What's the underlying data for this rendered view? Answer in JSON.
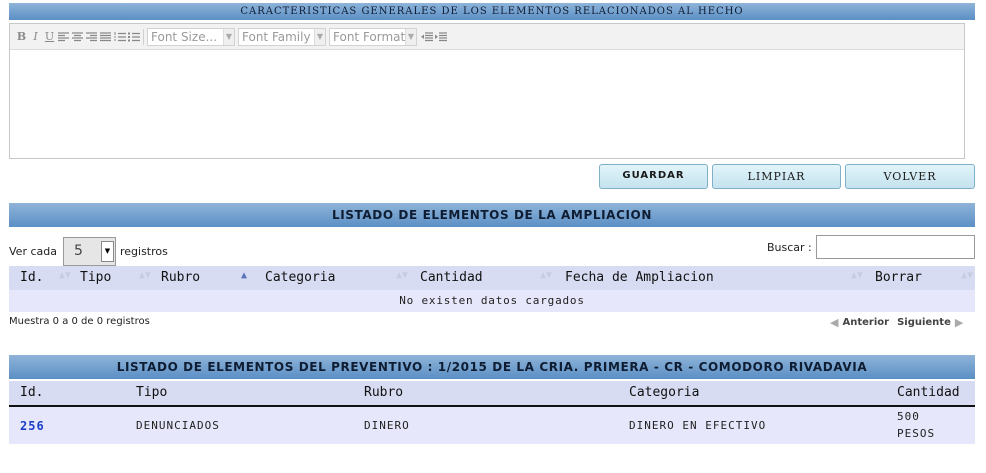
{
  "header_generales": "CARACTERISTICAS GENERALES DE LOS ELEMENTOS RELACIONADOS AL HECHO",
  "toolbar": {
    "bold": "B",
    "italic": "I",
    "underline": "U",
    "font_size": "Font Size...",
    "font_family": "Font Family",
    "font_format": "Font Format",
    "icons": [
      "bold-icon",
      "italic-icon",
      "underline-icon",
      "align-left-icon",
      "align-center-icon",
      "align-right-icon",
      "align-justify-icon",
      "ordered-list-icon",
      "unordered-list-icon",
      "outdent-icon",
      "indent-icon"
    ]
  },
  "buttons": {
    "guardar": "GUARDAR",
    "limpiar": "LIMPIAR",
    "volver": "VOLVER"
  },
  "ampliacion": {
    "title": "LISTADO DE ELEMENTOS DE LA AMPLIACION",
    "ver_cada": "Ver cada",
    "page_size": "5",
    "registros": "registros",
    "buscar": "Buscar :",
    "columns": [
      "Id.",
      "Tipo",
      "Rubro",
      "Categoria",
      "Cantidad",
      "Fecha de Ampliacion",
      "Borrar"
    ],
    "empty": "No existen datos cargados",
    "muestra": "Muestra 0 a 0 de 0 registros",
    "anterior": "Anterior",
    "siguiente": "Siguiente"
  },
  "preventivo": {
    "title": "LISTADO DE ELEMENTOS DEL PREVENTIVO : 1/2015 DE LA CRIA. PRIMERA - CR - COMODORO RIVADAVIA",
    "columns": [
      "Id.",
      "Tipo",
      "Rubro",
      "Categoria",
      "Cantidad"
    ],
    "rows": [
      {
        "id": "256",
        "tipo": "DENUNCIADOS",
        "rubro": "DINERO",
        "categoria": "DINERO EN EFECTIVO",
        "cantidad_1": "500",
        "cantidad_2": "PESOS"
      }
    ]
  },
  "colors": {
    "header_bar": "#6b9bcb",
    "row_bg": "#e7e7fb",
    "header_row_bg": "#d8dcf2",
    "link": "#1a3fc6"
  }
}
